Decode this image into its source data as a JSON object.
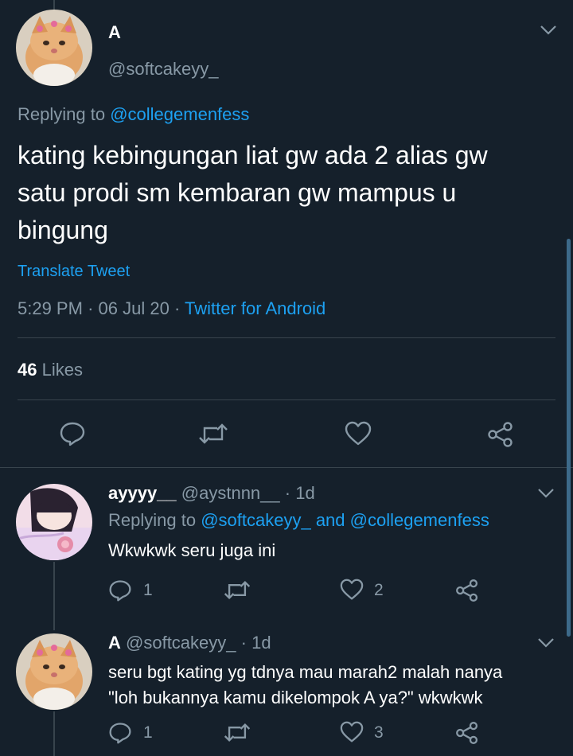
{
  "main_tweet": {
    "name": "A",
    "handle": "@softcakeyy_",
    "replying_prefix": "Replying to",
    "replying_handle": "@collegemenfess",
    "text_line1": "kating kebingungan liat gw ada 2 alias gw",
    "text_line2": "satu prodi sm kembaran gw mampus u",
    "text_line3": "bingung",
    "translate": "Translate Tweet",
    "time": "5:29 PM",
    "date": "06 Jul 20",
    "sep": "·",
    "source": "Twitter for Android",
    "likes_count": "46",
    "likes_label": "Likes"
  },
  "replies": [
    {
      "name": "ayyyy__",
      "handle": "@aystnnn__",
      "age": "· 1d",
      "replying_prefix": "Replying to",
      "replying_handles": "@softcakeyy_ and @collegemenfess",
      "text": "Wkwkwk seru juga ini",
      "reply_count": "1",
      "like_count": "2"
    },
    {
      "name": "A",
      "handle": "@softcakeyy_",
      "age": "· 1d",
      "text_line1": "seru bgt kating yg tdnya mau marah2 malah nanya",
      "text_line2": "\"loh bukannya kamu dikelompok A ya?\" wkwkwk",
      "reply_count": "1",
      "like_count": "3"
    }
  ],
  "icons": {
    "reply": "reply-icon",
    "retweet": "retweet-icon",
    "like": "heart-icon",
    "share": "share-icon",
    "more": "chevron-down-icon"
  },
  "colors": {
    "background": "#15202b",
    "link": "#1da1f2",
    "muted": "#8899a6",
    "divider": "#38444d"
  }
}
